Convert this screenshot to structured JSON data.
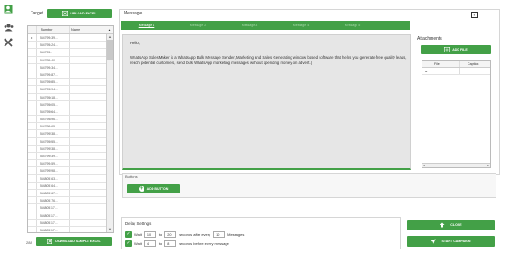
{
  "sidebar": {
    "icons": [
      "user-add-icon",
      "users-icon",
      "tools-icon"
    ]
  },
  "target": {
    "label": "Target",
    "upload_label": "UPLOAD EXCEL",
    "columns": {
      "number": "Number",
      "name": "Name"
    },
    "rows": [
      "554799439...",
      "554795424...",
      "554795...",
      "554795440...",
      "554799434...",
      "554799487...",
      "554795085...",
      "554795094...",
      "554795618...",
      "554795605...",
      "554795064...",
      "554795896...",
      "554799465...",
      "554799538...",
      "554795055...",
      "554799538...",
      "554799539...",
      "554799459...",
      "554799598...",
      "554805163...",
      "554805164...",
      "554805167...",
      "554805176...",
      "554805117...",
      "554805117...",
      "554805117...",
      "554805117...",
      "554805117..."
    ],
    "row_selector": "▸",
    "count": "288",
    "download_label": "DOWNLOAD SAMPLE EXCEL"
  },
  "message": {
    "title": "Message",
    "tabs": [
      "Message 1",
      "Message 2",
      "Message 3",
      "Message 4",
      "Message 5"
    ],
    "greeting": "Hello,",
    "body": "WhatsApp  SalesMaker is a WhatsApp Bulk Message Sender, Marketing and Sales Generating  window based software that helps you generate free quality leads, reach potential customers, send bulk WhatsApp  marketing messages without spending money on advert. |"
  },
  "attachments": {
    "title": "Attachments",
    "add_label": "ADD FILE",
    "columns": {
      "file": "File",
      "caption": "Caption"
    },
    "row_selector": "▸"
  },
  "buttons": {
    "title": "Buttons",
    "add_label": "ADD BUTTON"
  },
  "delay": {
    "title": "Delay Settings",
    "row1": {
      "wait": "Wait",
      "from": "10",
      "to_label": "to",
      "to": "20",
      "after_text": "seconds after every",
      "every": "10",
      "end_text": "Messages"
    },
    "row2": {
      "wait": "Wait",
      "from": "4",
      "to_label": "to",
      "to": "8",
      "after_text": "seconds before every message"
    }
  },
  "actions": {
    "close_label": "CLOSE",
    "start_label": "START CAMPAIGN"
  },
  "colors": {
    "accent": "#43a047",
    "editor_bg": "#e6e6e6"
  }
}
